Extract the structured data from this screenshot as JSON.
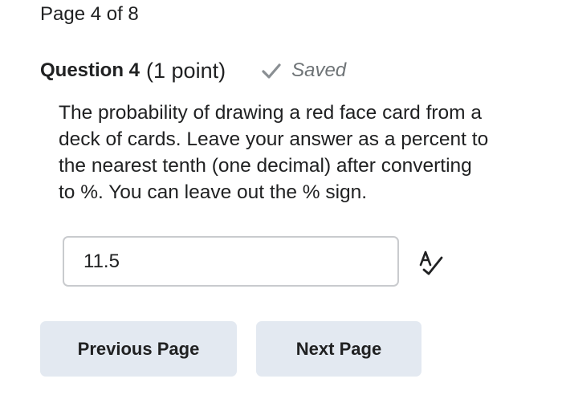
{
  "page": {
    "indicator": "Page 4 of 8"
  },
  "question": {
    "title": "Question 4",
    "points": "(1 point)",
    "status": "Saved",
    "text": "The probability of drawing a red face card from a\ndeck of cards.   Leave your answer as a percent to\nthe nearest tenth (one decimal) after converting\nto %.  You can leave out the % sign."
  },
  "answer": {
    "value": "11.5"
  },
  "icons": {
    "status": "checkmark-icon",
    "spellcheck": "spellcheck-icon"
  },
  "colors": {
    "button_bg": "#e3e9f1",
    "input_border": "#c9cbce",
    "saved_gray": "#6e7376"
  },
  "nav": {
    "previous_label": "Previous Page",
    "next_label": "Next Page"
  }
}
